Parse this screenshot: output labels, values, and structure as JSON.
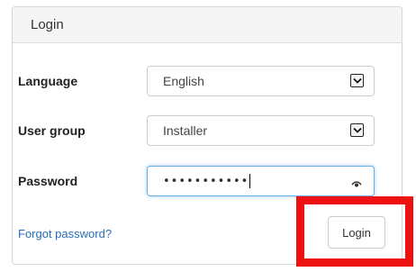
{
  "panel": {
    "title": "Login"
  },
  "form": {
    "language": {
      "label": "Language",
      "value": "English",
      "icon": "chevron-down-icon"
    },
    "user_group": {
      "label": "User group",
      "value": "Installer",
      "icon": "chevron-down-icon"
    },
    "password": {
      "label": "Password",
      "masked_value": "•••••••••••",
      "icon": "eye-icon"
    }
  },
  "footer": {
    "forgot_password": "Forgot password?",
    "login_button": "Login"
  },
  "colors": {
    "highlight": "#ee1111",
    "link": "#2a6fb5",
    "focus_border": "#66afe9"
  }
}
